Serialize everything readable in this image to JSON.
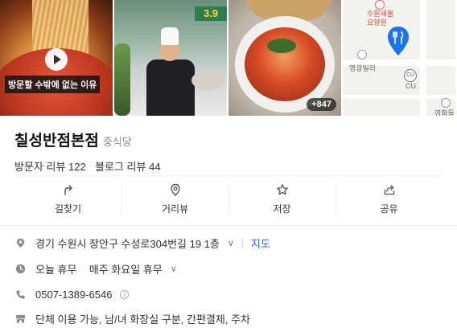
{
  "gallery": {
    "video_caption": "방문할 수밖에 없는 이유",
    "chef_sign_text": "3.9",
    "photo_count": "+847",
    "map": {
      "label_top": "수원새봄\n요양원",
      "label_left": "영광빌라",
      "label_cu": "CU",
      "label_bottom_right": "영화동",
      "pin_color": "#1e73e8"
    }
  },
  "place": {
    "name": "칠성반점본점",
    "category": "중식당",
    "visitor_reviews": "방문자 리뷰 122",
    "blog_reviews": "블로그 리뷰 44"
  },
  "actions": [
    {
      "label": "길찾기",
      "icon": "directions-icon"
    },
    {
      "label": "거리뷰",
      "icon": "street-view-icon"
    },
    {
      "label": "저장",
      "icon": "star-icon"
    },
    {
      "label": "공유",
      "icon": "share-icon"
    }
  ],
  "details": {
    "address": "경기 수원시 장안구 수성로304번길 19 1층",
    "map_link": "지도",
    "hours_status": "오늘 휴무",
    "hours_note": "매주 화요일 휴무",
    "phone": "0507-1389-6546",
    "amenities": "단체 이용 가능, 남/녀 화장실 구분, 간편결제, 주차"
  },
  "colors": {
    "accent_link": "#1f63d6",
    "icon_gray": "#8a8a8a"
  }
}
